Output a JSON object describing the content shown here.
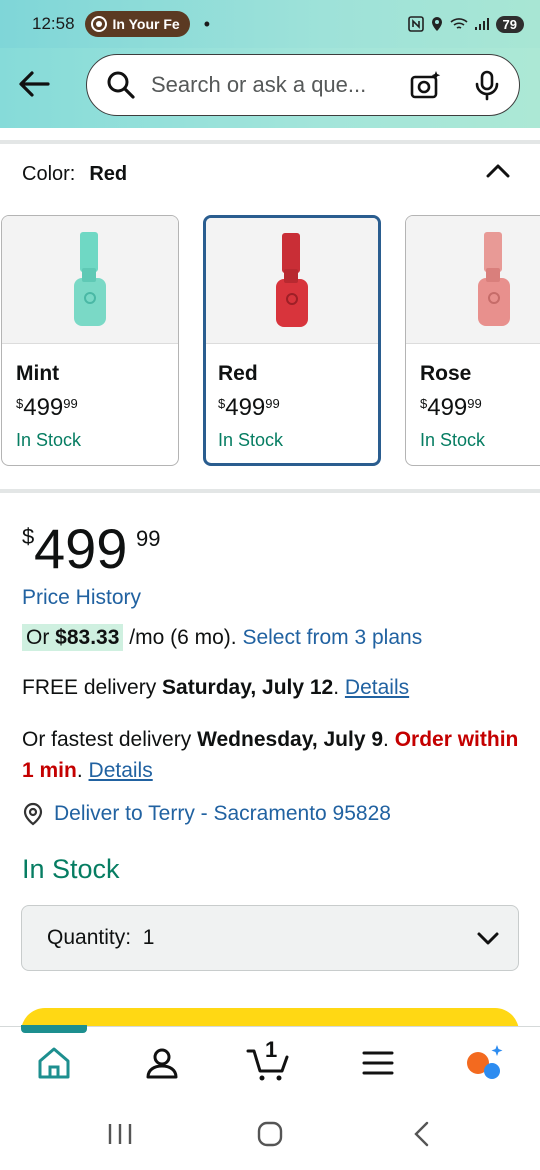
{
  "status_bar": {
    "time": "12:58",
    "notification_pill": "In Your Fe",
    "battery": "79"
  },
  "search": {
    "placeholder": "Search or ask a que..."
  },
  "color_selector": {
    "label": "Color:",
    "selected": "Red",
    "options": [
      {
        "name": "Mint",
        "price_symbol": "$",
        "price_whole": "499",
        "price_fraction": "99",
        "availability": "In Stock",
        "color": "#6fd8c4"
      },
      {
        "name": "Red",
        "price_symbol": "$",
        "price_whole": "499",
        "price_fraction": "99",
        "availability": "In Stock",
        "color": "#d8343c"
      },
      {
        "name": "Rose",
        "price_symbol": "$",
        "price_whole": "499",
        "price_fraction": "99",
        "availability": "In Stock",
        "color": "#e8908d"
      }
    ]
  },
  "price": {
    "symbol": "$",
    "whole": "499",
    "fraction": "99",
    "history_link": "Price History"
  },
  "installments": {
    "prefix": "Or ",
    "amount": "$83.33",
    "suffix": " /mo (6 mo). ",
    "plans_link": "Select from 3 plans"
  },
  "delivery": {
    "free_prefix": "FREE delivery ",
    "free_date": "Saturday, July 12",
    "free_period": ". ",
    "details_link": "Details",
    "fast_prefix": "Or fastest delivery ",
    "fast_date": "Wednesday, July 9",
    "fast_period": ". ",
    "order_within": "Order within 1 min",
    "fast_period2": ". ",
    "fast_details_link": "Details"
  },
  "deliver_to": "Deliver to Terry - Sacramento 95828",
  "availability": "In Stock",
  "quantity": {
    "label": "Quantity:",
    "value": "1"
  },
  "bottom_nav": {
    "cart_count": "1"
  },
  "colors": {
    "link": "#2162a1",
    "in_stock": "#067d62",
    "urgent": "#c40000",
    "buy_button": "#ffd814",
    "selected_border": "#2a5d8f"
  }
}
